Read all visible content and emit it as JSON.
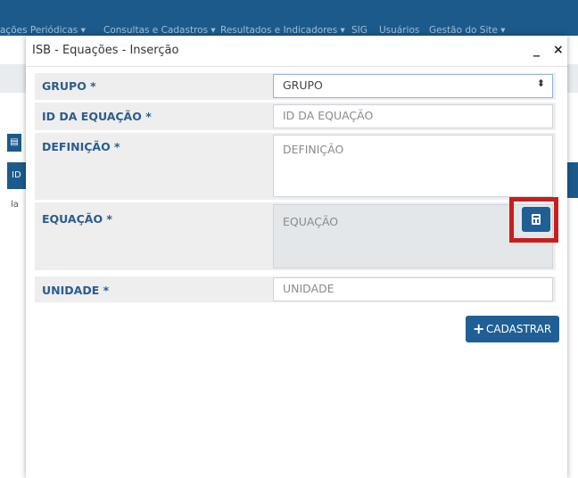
{
  "background": {
    "nav": [
      "ações Periódicas ▾",
      "Consultas e Cadastros ▾",
      "Resultados e Indicadores ▾",
      "SIG",
      "Usuários",
      "Gestão do Site ▾"
    ],
    "id_label": "ID",
    "row_text": "la"
  },
  "modal": {
    "title": "ISB - Equações - Inserção",
    "minimize_glyph": "_",
    "close_glyph": "×"
  },
  "form": {
    "grupo": {
      "label": "GRUPO *",
      "value": "GRUPO"
    },
    "id_equacao": {
      "label": "ID DA EQUAÇÃO *",
      "placeholder": "ID DA EQUAÇÃO"
    },
    "definicao": {
      "label": "DEFINIÇÃO *",
      "placeholder": "DEFINIÇÃO"
    },
    "equacao": {
      "label": "EQUAÇÃO *",
      "placeholder": "EQUAÇÃO"
    },
    "unidade": {
      "label": "UNIDADE *",
      "placeholder": "UNIDADE"
    },
    "submit_label": "CADASTRAR"
  },
  "colors": {
    "brand": "#1f5f96",
    "label": "#2a5d8f",
    "highlight": "#c81e1e"
  }
}
